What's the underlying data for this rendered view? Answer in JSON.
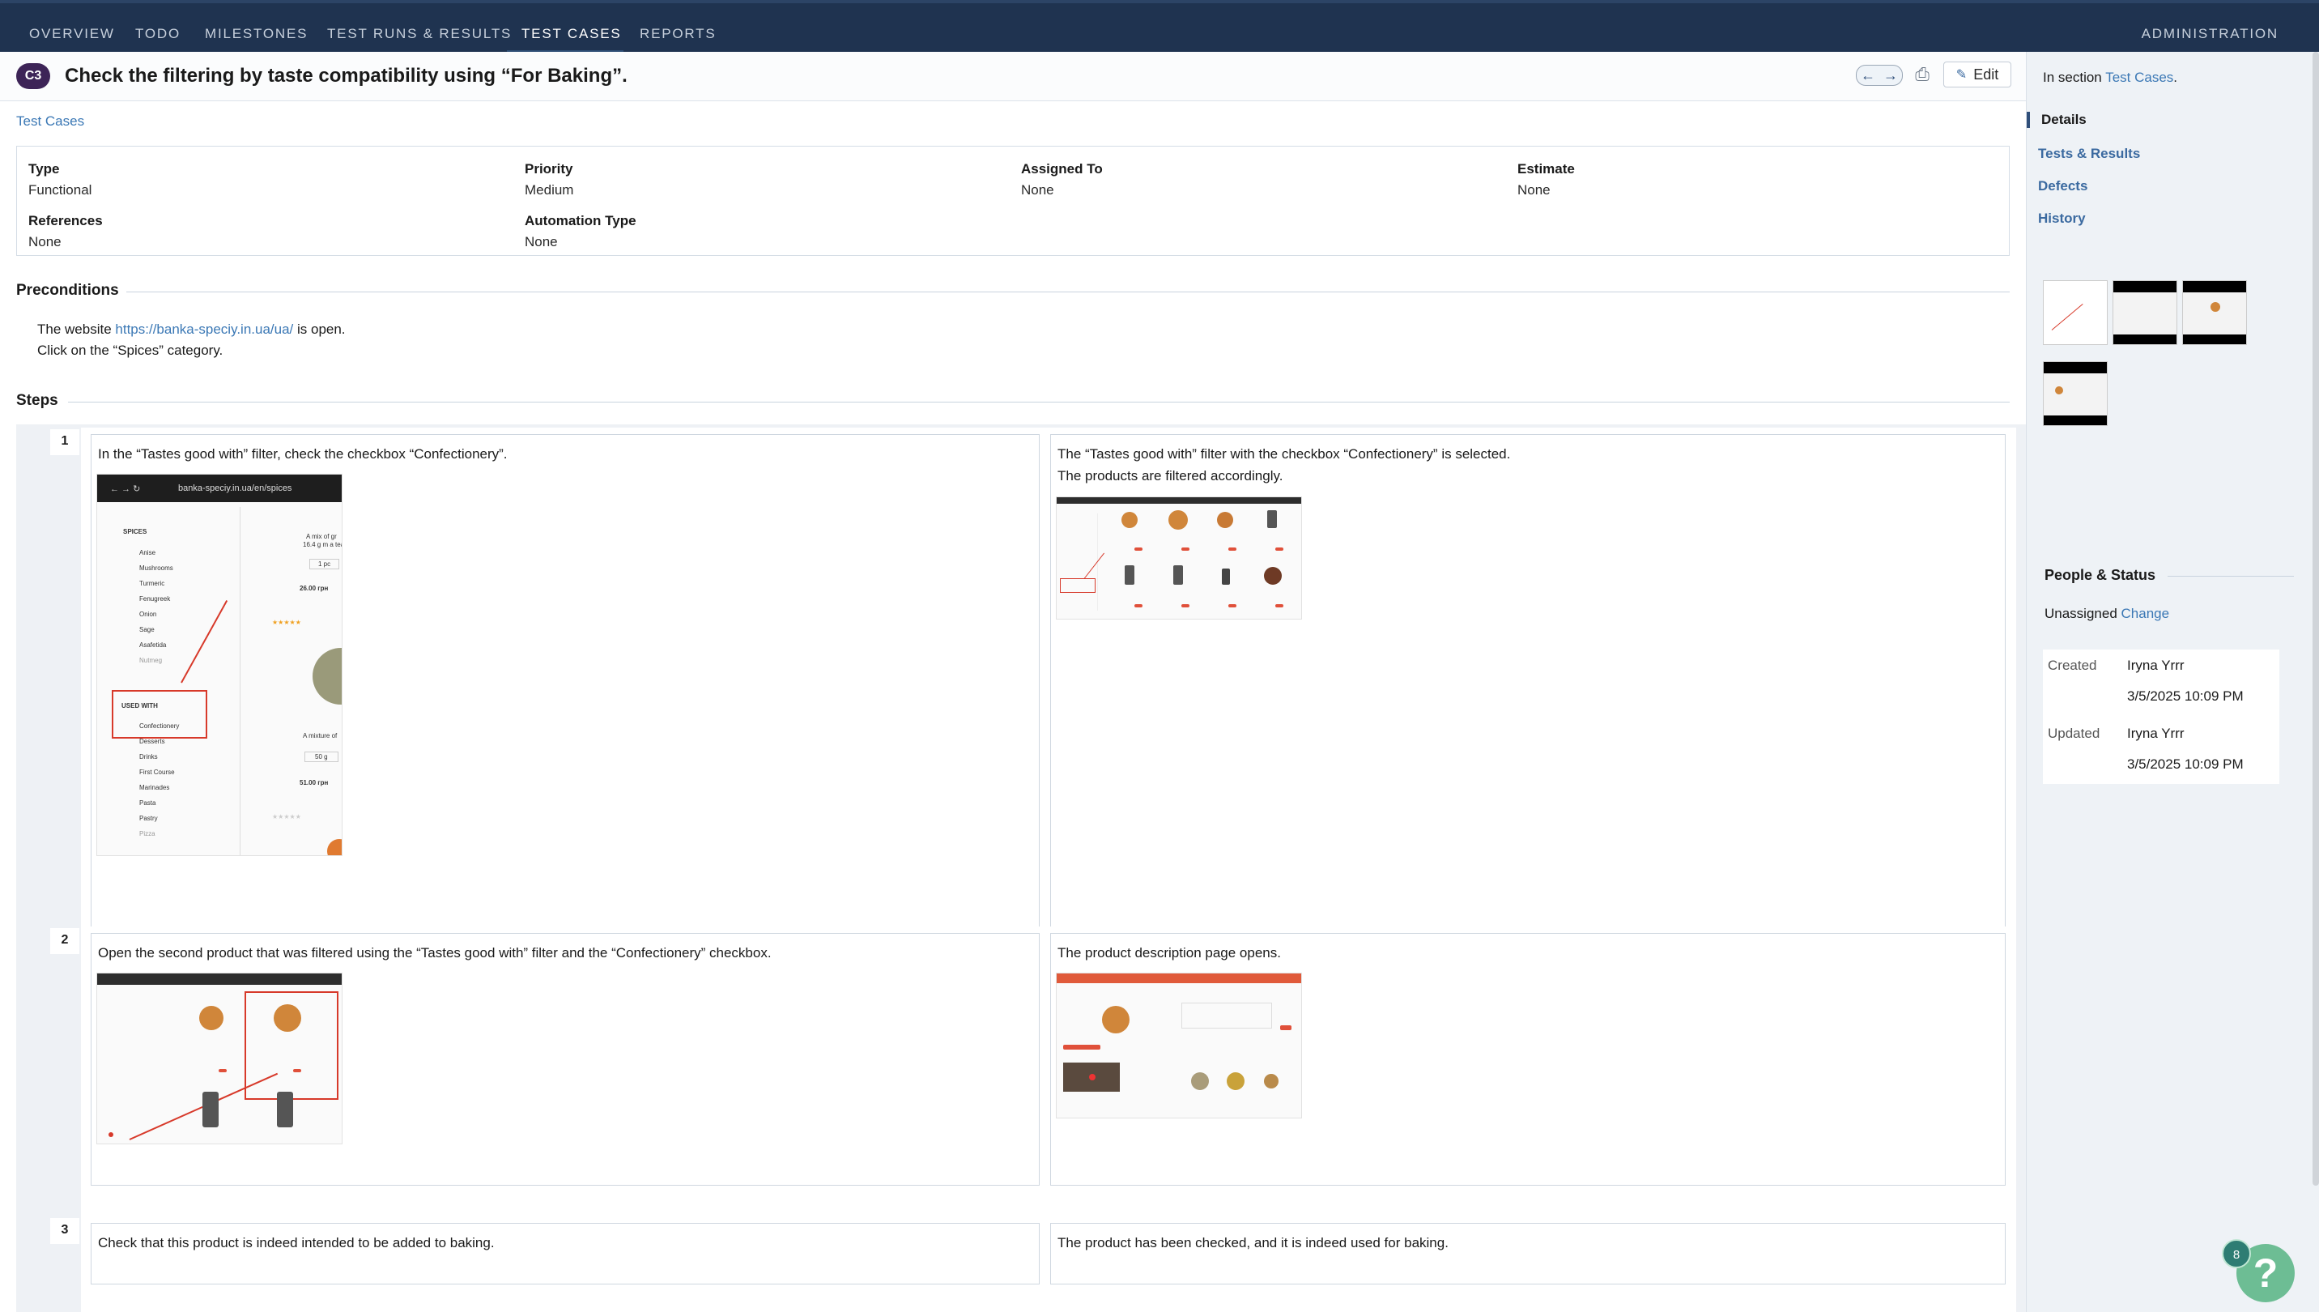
{
  "nav": {
    "tabs": [
      "Overview",
      "Todo",
      "Milestones",
      "Test Runs & Results",
      "Test Cases",
      "Reports"
    ],
    "active_tab": "Test Cases",
    "admin": "Administration"
  },
  "case": {
    "badge": "C3",
    "title": "Check the filtering by taste compatibility using “For Baking”.",
    "edit_label": "Edit",
    "breadcrumb": "Test Cases"
  },
  "properties": {
    "type_label": "Type",
    "type_value": "Functional",
    "priority_label": "Priority",
    "priority_value": "Medium",
    "assigned_label": "Assigned To",
    "assigned_value": "None",
    "estimate_label": "Estimate",
    "estimate_value": "None",
    "references_label": "References",
    "references_value": "None",
    "automation_label": "Automation Type",
    "automation_value": "None"
  },
  "preconditions": {
    "heading": "Preconditions",
    "line1_prefix": "The website ",
    "line1_link": "https://banka-speciy.in.ua/ua/",
    "line1_suffix": " is open.",
    "line2": "Click on the “Spices” category."
  },
  "steps": {
    "heading": "Steps",
    "items": [
      {
        "number": "1",
        "action": "In the “Tastes good with” filter, check the checkbox “Confectionery”.",
        "expected_line1": "The “Tastes good with” filter with the checkbox “Confectionery” is selected.",
        "expected_line2": "The products are filtered accordingly."
      },
      {
        "number": "2",
        "action": "Open the second product that was filtered using the “Tastes good with” filter and the “Confectionery” checkbox.",
        "expected_line1": "The product description page opens."
      },
      {
        "number": "3",
        "action": "Check that this product is indeed intended to be added to baking.",
        "expected_line1": "The product has been checked, and it is indeed used for baking."
      }
    ],
    "shot1": {
      "url": "banka-speciy.in.ua/en/spices",
      "spices_heading": "SPICES",
      "spices": [
        "Anise",
        "Mushrooms",
        "Turmeric",
        "Fenugreek",
        "Onion",
        "Sage",
        "Asafetida",
        "Nutmeg"
      ],
      "used_heading": "USED WITH",
      "used": [
        "Confectionery",
        "Desserts",
        "Drinks",
        "First Course",
        "Marinades",
        "Pasta",
        "Pastry",
        "Pizza"
      ],
      "price1": "26.00 грн",
      "price2": "51.00 грн",
      "desc1": "A mix of gr",
      "desc2": "16.4 g m a tea",
      "desc3": "A mixture of",
      "qty1": "1 pc",
      "qty2": "50 g"
    }
  },
  "right_panel": {
    "section_prefix": "In section ",
    "section_link": "Test Cases",
    "section_suffix": ".",
    "tabs": [
      "Details",
      "Tests & Results",
      "Defects",
      "History"
    ],
    "people_heading": "People & Status",
    "unassigned": "Unassigned",
    "change": "Change",
    "created_label": "Created",
    "created_by": "Iryna Yrrr",
    "created_at": "3/5/2025 10:09 PM",
    "updated_label": "Updated",
    "updated_by": "Iryna Yrrr",
    "updated_at": "3/5/2025 10:09 PM"
  },
  "help": {
    "badge": "8",
    "icon": "?"
  }
}
